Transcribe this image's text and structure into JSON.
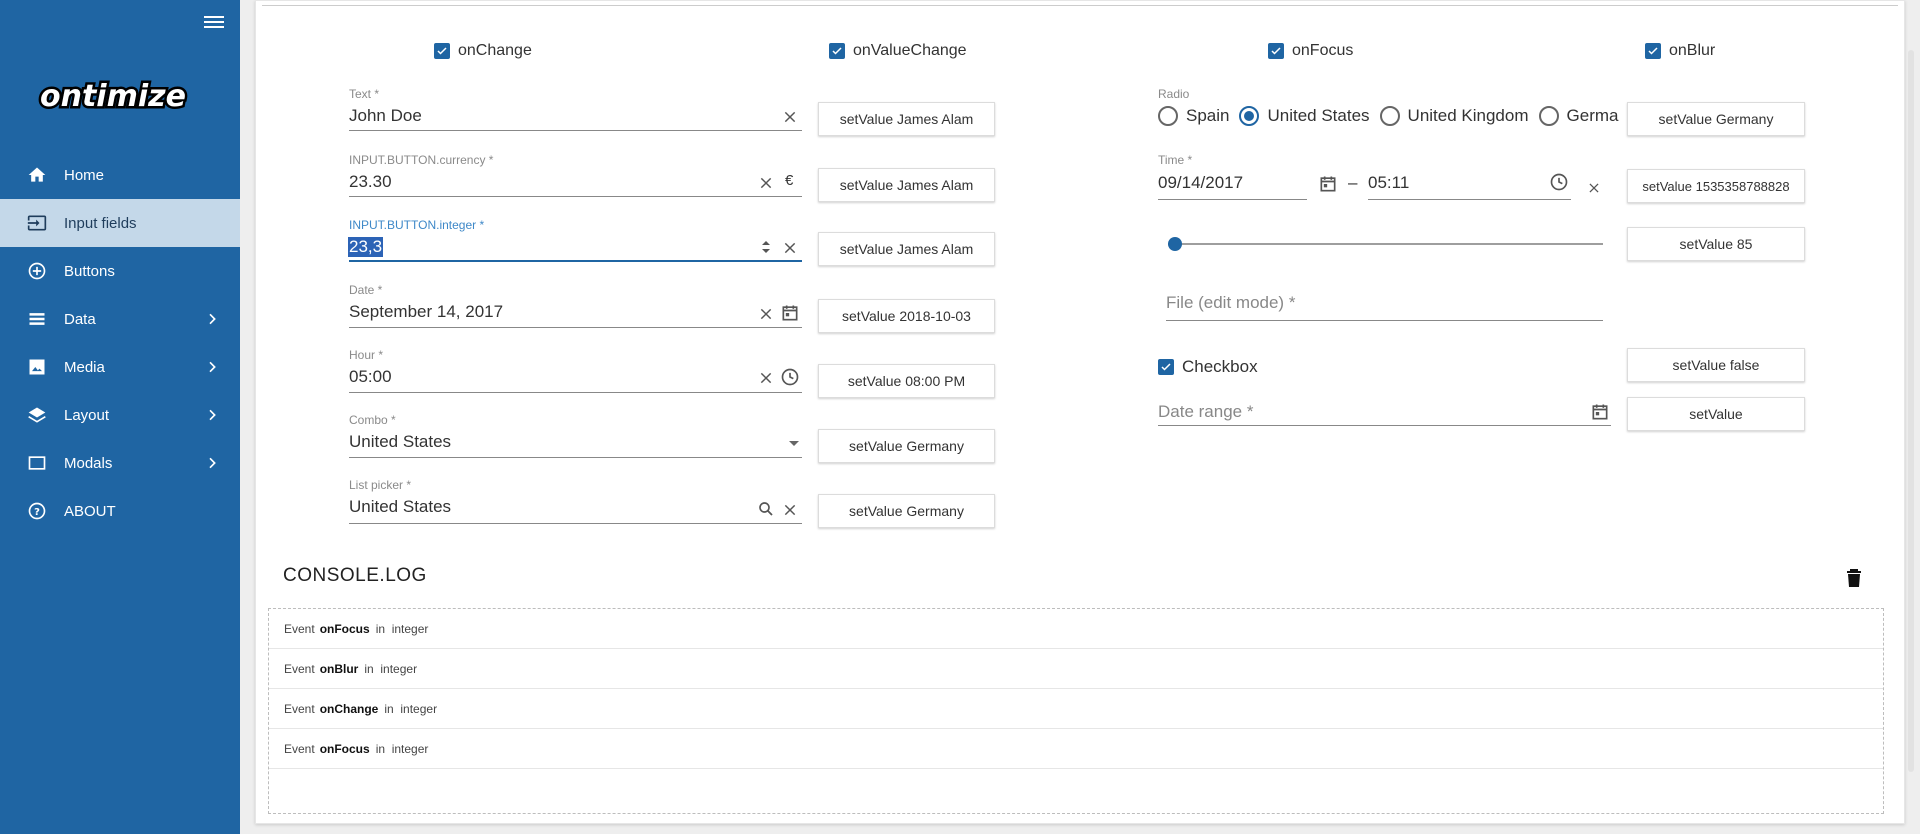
{
  "app": {
    "title": "ontimize",
    "accent": "#1f65a3",
    "active_bg": "#c4d8e9"
  },
  "sidebar": {
    "items": [
      {
        "label": "Home",
        "icon": "home-icon",
        "chevron": false
      },
      {
        "label": "Input fields",
        "icon": "input-icon",
        "chevron": false,
        "active": true
      },
      {
        "label": "Buttons",
        "icon": "add-circle-icon",
        "chevron": false
      },
      {
        "label": "Data",
        "icon": "list-icon",
        "chevron": true
      },
      {
        "label": "Media",
        "icon": "image-icon",
        "chevron": true
      },
      {
        "label": "Layout",
        "icon": "layers-icon",
        "chevron": true
      },
      {
        "label": "Modals",
        "icon": "window-icon",
        "chevron": true
      },
      {
        "label": "ABOUT",
        "icon": "help-icon",
        "chevron": false
      }
    ]
  },
  "events": {
    "onChange": "onChange",
    "onValueChange": "onValueChange",
    "onFocus": "onFocus",
    "onBlur": "onBlur"
  },
  "left_fields": [
    {
      "label": "Text *",
      "value": "John Doe",
      "button": "setValue James Alam"
    },
    {
      "label": "INPUT.BUTTON.currency *",
      "value": "23.30",
      "suffix": "€",
      "button": "setValue James Alam"
    },
    {
      "label": "INPUT.BUTTON.integer *",
      "value": "23,3",
      "button": "setValue James Alam"
    },
    {
      "label": "Date *",
      "value": "September 14, 2017",
      "button": "setValue 2018-10-03"
    },
    {
      "label": "Hour *",
      "value": "05:00",
      "button": "setValue 08:00 PM"
    },
    {
      "label": "Combo *",
      "value": "United States",
      "button": "setValue Germany"
    },
    {
      "label": "List picker *",
      "value": "United States",
      "button": "setValue Germany"
    }
  ],
  "radio": {
    "label": "Radio",
    "options": [
      "Spain",
      "United States",
      "United Kingdom",
      "Germa"
    ],
    "selected": "United States",
    "button": "setValue Germany"
  },
  "time": {
    "label": "Time *",
    "date": "09/14/2017",
    "separator": "–",
    "hour": "05:11",
    "button": "setValue 1535358788828"
  },
  "slider": {
    "value": 0,
    "button": "setValue 85"
  },
  "file": {
    "placeholder": "File (edit mode) *"
  },
  "checkbox": {
    "label": "Checkbox",
    "checked": true,
    "button": "setValue false"
  },
  "date_range": {
    "placeholder": "Date range *",
    "button": "setValue"
  },
  "console": {
    "title": "CONSOLE.LOG",
    "rows": [
      {
        "prefix": "Event",
        "event": "onFocus",
        "mid": "in",
        "field": "integer"
      },
      {
        "prefix": "Event",
        "event": "onBlur",
        "mid": "in",
        "field": "integer"
      },
      {
        "prefix": "Event",
        "event": "onChange",
        "mid": "in",
        "field": "integer"
      },
      {
        "prefix": "Event",
        "event": "onFocus",
        "mid": "in",
        "field": "integer"
      }
    ]
  }
}
